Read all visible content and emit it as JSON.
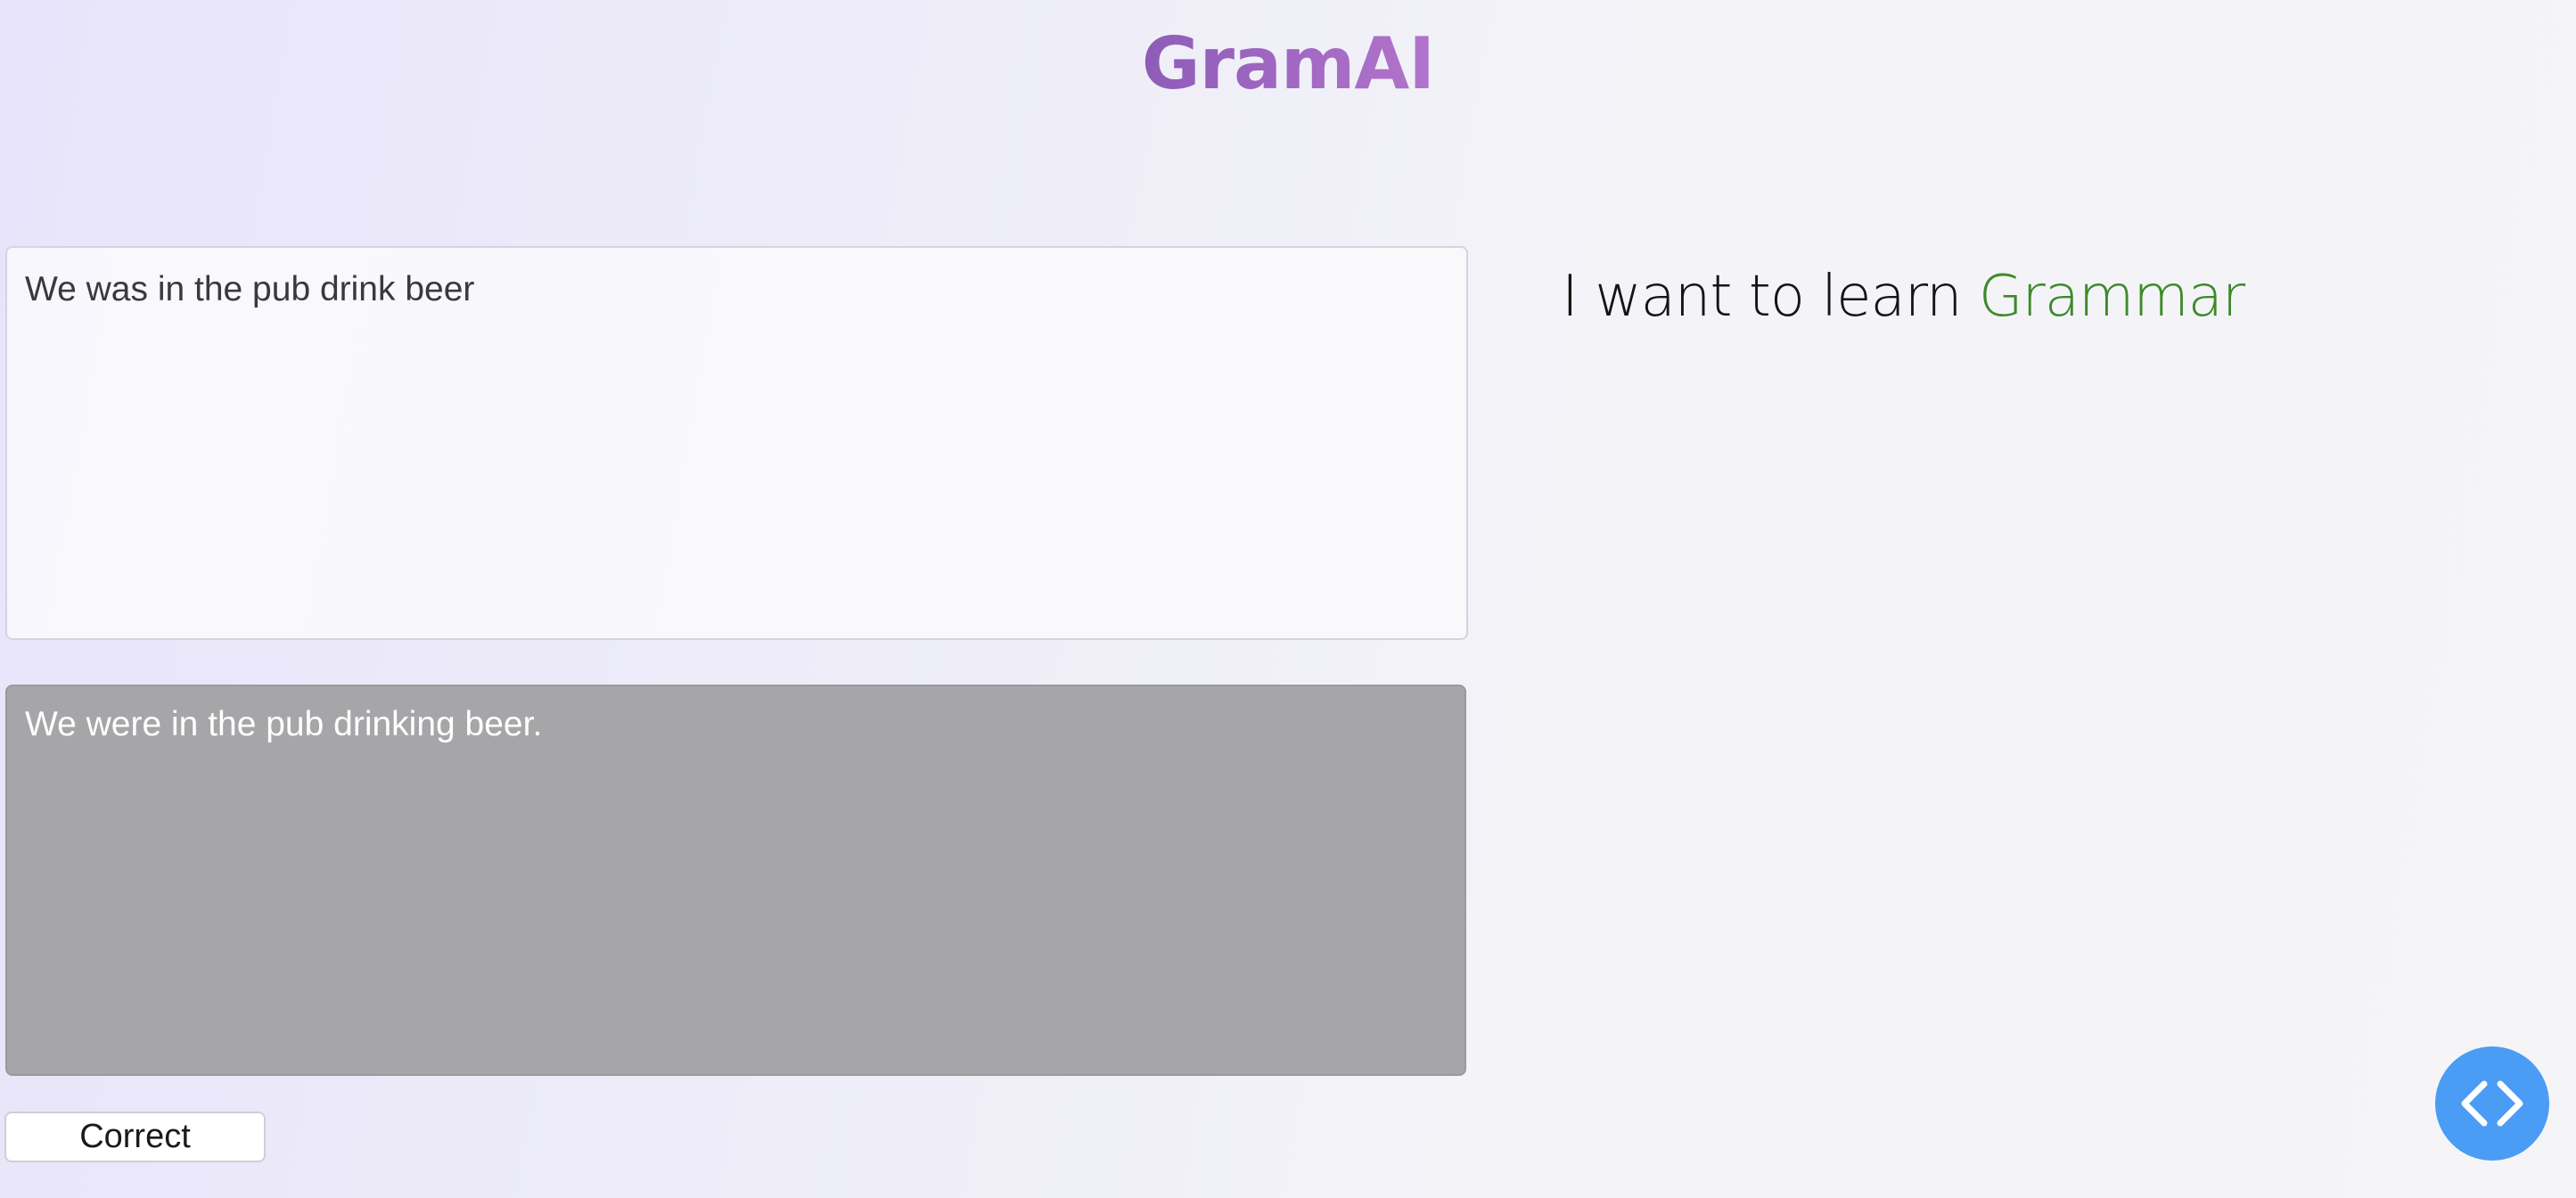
{
  "header": {
    "brand": "GramAI"
  },
  "editor": {
    "input_text": "We was in the pub drink beer",
    "output_text": "We were in the pub drinking beer.",
    "correct_button_label": "Correct"
  },
  "tagline": {
    "prefix": "I want to learn",
    "highlight": "Grammar",
    "highlight_color": "#3d8a2a"
  },
  "fab": {
    "icon": "code-icon",
    "color": "#4a9cf5"
  }
}
